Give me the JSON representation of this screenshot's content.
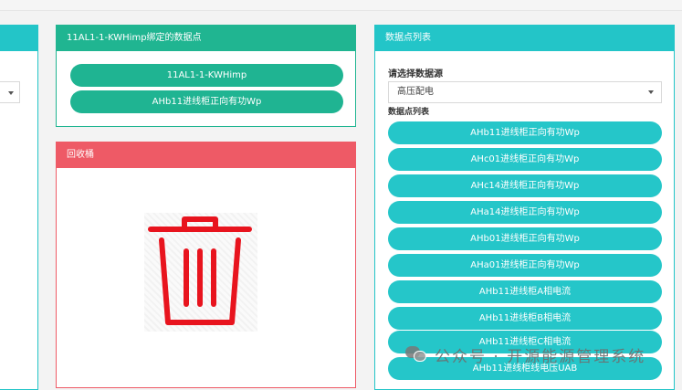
{
  "bound_panel": {
    "title": "11AL1-1-KWHimp绑定的数据点",
    "points": [
      "11AL1-1-KWHimp",
      "AHb11进线柜正向有功Wp"
    ]
  },
  "recycle_panel": {
    "title": "回收桶",
    "icon": "trash-icon",
    "icon_color": "#e8141e"
  },
  "list_panel": {
    "title": "数据点列表",
    "source_label": "请选择数据源",
    "source_value": "高压配电",
    "list_label": "数据点列表",
    "points": [
      "AHb11进线柜正向有功Wp",
      "AHc01进线柜正向有功Wp",
      "AHc14进线柜正向有功Wp",
      "AHa14进线柜正向有功Wp",
      "AHb01进线柜正向有功Wp",
      "AHa01进线柜正向有功Wp",
      "AHb11进线柜A相电流",
      "AHb11进线柜B相电流",
      "AHb11进线柜C相电流",
      "AHb11进线柜线电压UAB"
    ]
  },
  "watermark": {
    "text": "公众号 · 开源能源管理系统"
  },
  "colors": {
    "teal": "#1fb492",
    "cyan": "#25c6c9",
    "red": "#ee5a66"
  }
}
